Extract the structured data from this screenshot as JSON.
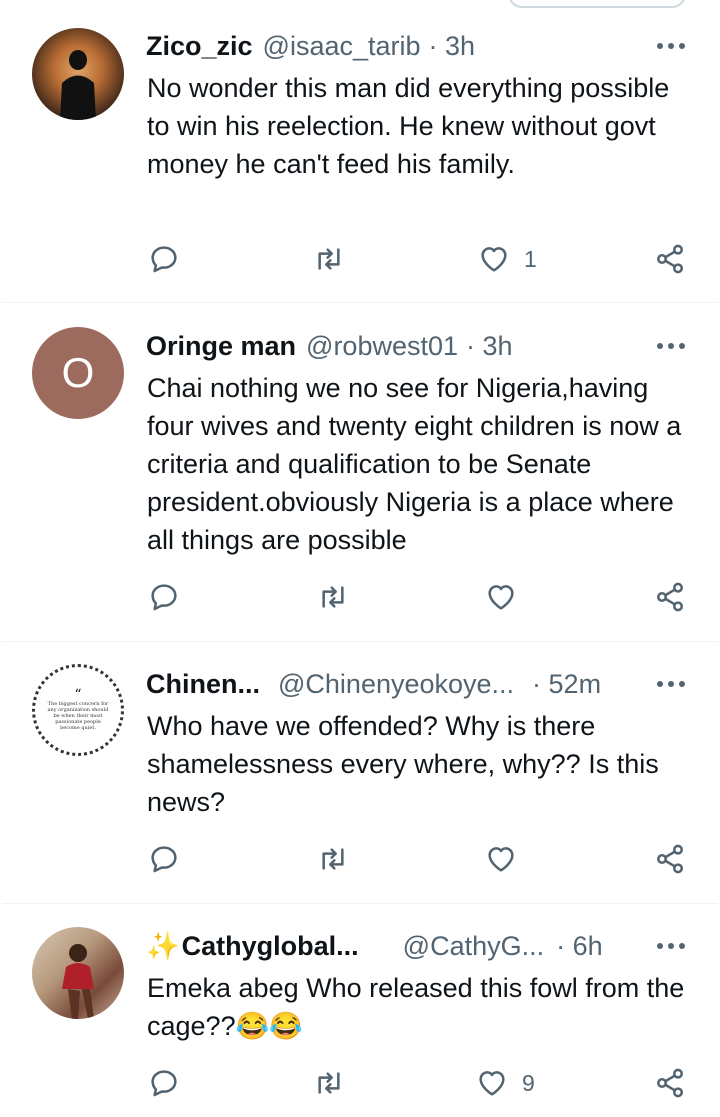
{
  "tweets": [
    {
      "name": "Zico_zic",
      "handle": "@isaac_tarib",
      "time": "· 3h",
      "text": "No wonder this man did everything possible to win his reelection. He knew without govt money he can't feed his family.",
      "likes": "1"
    },
    {
      "name": "Oringe man",
      "handle": "@robwest01",
      "time": "· 3h",
      "avatar_letter": "O",
      "avatar_color": "#9c6b5e",
      "text": "Chai nothing we no see for Nigeria,having four wives and twenty eight children is now a criteria and qualification to be Senate president.obviously Nigeria is a place where all things are possible",
      "likes": ""
    },
    {
      "name": "Chinen...",
      "handle": "@Chinenyeokoye...",
      "time": "· 52m",
      "avatar_text": "The biggest concern for any organization should be when their most passionate people become quiet.",
      "text": "Who have we offended? Why is there shamelessness every where, why?? Is this news?",
      "likes": ""
    },
    {
      "name_emoji": "✨",
      "name": "Cathyglobal...",
      "handle": "@CathyG...",
      "time": "· 6h",
      "text": "Emeka abeg Who released this fowl from the cage??😂😂",
      "likes": "9"
    }
  ],
  "colors": {
    "secondary": "#536471",
    "divider": "#eff3f4",
    "primary": "#0f1419"
  },
  "icons": [
    "reply-icon",
    "retweet-icon",
    "like-icon",
    "share-icon",
    "more-icon"
  ]
}
